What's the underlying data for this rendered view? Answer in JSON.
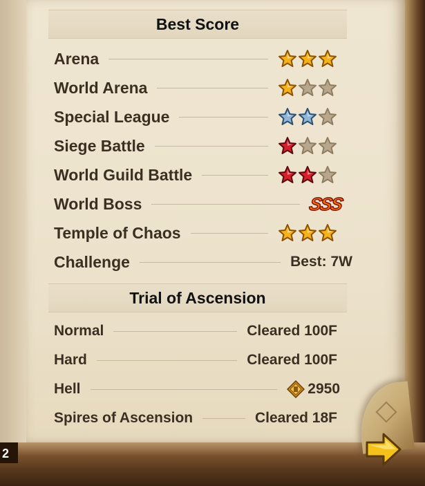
{
  "best_score": {
    "title": "Best Score",
    "rows": [
      {
        "label": "Arena",
        "stars": [
          "gold",
          "gold",
          "gold"
        ]
      },
      {
        "label": "World Arena",
        "stars": [
          "gold",
          "empty",
          "empty"
        ]
      },
      {
        "label": "Special League",
        "stars": [
          "silver",
          "silver",
          "empty"
        ]
      },
      {
        "label": "Siege Battle",
        "stars": [
          "red",
          "empty",
          "empty"
        ]
      },
      {
        "label": "World Guild Battle",
        "stars": [
          "red",
          "red",
          "empty"
        ]
      },
      {
        "label": "World Boss",
        "rank": "SSS"
      },
      {
        "label": "Temple of Chaos",
        "stars": [
          "gold",
          "gold",
          "gold"
        ]
      },
      {
        "label": "Challenge",
        "value": "Best: 7W"
      }
    ]
  },
  "trial": {
    "title": "Trial of Ascension",
    "rows": [
      {
        "label": "Normal",
        "value": "Cleared 100F"
      },
      {
        "label": "Hard",
        "value": "Cleared 100F"
      },
      {
        "label": "Hell",
        "value": "2950",
        "icon": "hell-medal-icon"
      },
      {
        "label": "Spires of Ascension",
        "value": "Cleared 18F"
      }
    ]
  },
  "page_number": "2",
  "colors": {
    "gold_star": "#f6b21a",
    "silver_star": "#8fb6d8",
    "red_star": "#d8202a",
    "empty_star": "#b8a78c",
    "arrow": "#f5c21b"
  }
}
